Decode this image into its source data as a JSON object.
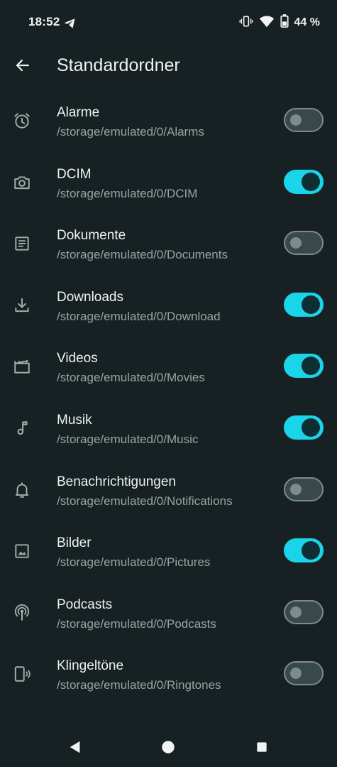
{
  "status_bar": {
    "time": "18:52",
    "battery_text": "44 %",
    "icons": [
      "telegram-send-icon",
      "vibrate-icon",
      "wifi-icon",
      "battery-icon"
    ]
  },
  "app_bar": {
    "title": "Standardordner",
    "back_icon": "arrow-back-icon"
  },
  "colors": {
    "background": "#172123",
    "toggle_on": "#1ad4ea",
    "toggle_off": "#39484a",
    "text_primary": "#eef2f1",
    "text_secondary": "#98a4a3"
  },
  "folders": [
    {
      "name": "Alarme",
      "path": "/storage/emulated/0/Alarms",
      "icon": "alarm-clock-icon",
      "enabled": false
    },
    {
      "name": "DCIM",
      "path": "/storage/emulated/0/DCIM",
      "icon": "camera-icon",
      "enabled": true
    },
    {
      "name": "Dokumente",
      "path": "/storage/emulated/0/Documents",
      "icon": "document-icon",
      "enabled": false
    },
    {
      "name": "Downloads",
      "path": "/storage/emulated/0/Download",
      "icon": "download-icon",
      "enabled": true
    },
    {
      "name": "Videos",
      "path": "/storage/emulated/0/Movies",
      "icon": "movie-icon",
      "enabled": true
    },
    {
      "name": "Musik",
      "path": "/storage/emulated/0/Music",
      "icon": "music-note-icon",
      "enabled": true
    },
    {
      "name": "Benachrichtigungen",
      "path": "/storage/emulated/0/Notifications",
      "icon": "bell-icon",
      "enabled": false
    },
    {
      "name": "Bilder",
      "path": "/storage/emulated/0/Pictures",
      "icon": "image-icon",
      "enabled": true
    },
    {
      "name": "Podcasts",
      "path": "/storage/emulated/0/Podcasts",
      "icon": "podcast-icon",
      "enabled": false
    },
    {
      "name": "Klingeltöne",
      "path": "/storage/emulated/0/Ringtones",
      "icon": "ringtone-phone-icon",
      "enabled": false
    }
  ],
  "nav_bar": {
    "buttons": [
      "nav-back-icon",
      "nav-home-icon",
      "nav-recents-icon"
    ]
  }
}
